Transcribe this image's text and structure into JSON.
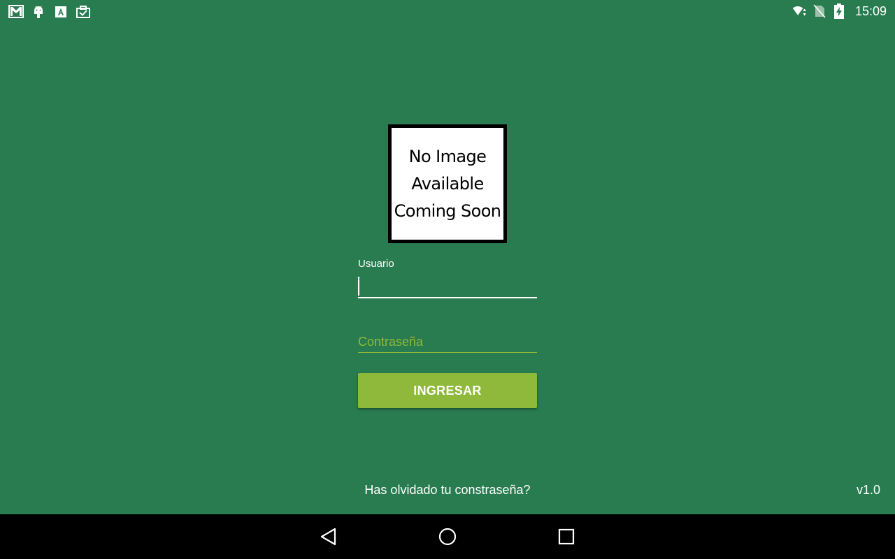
{
  "status_bar": {
    "time": "15:09",
    "left_icons": [
      "gmail-icon",
      "android-icon",
      "keyboard-a-icon",
      "task-icon"
    ],
    "right_icons": [
      "wifi-icon",
      "no-sim-icon",
      "battery-charging-icon"
    ]
  },
  "logo": {
    "lines": [
      "No Image",
      "Available",
      "Coming Soon"
    ]
  },
  "form": {
    "user_label": "Usuario",
    "user_value": "",
    "password_placeholder": "Contraseña",
    "submit_label": "INGRESAR"
  },
  "footer": {
    "forgot_password": "Has olvidado tu constraseña?",
    "version": "v1.0"
  },
  "nav_bar": {
    "buttons": [
      "back-icon",
      "home-icon",
      "recents-icon"
    ]
  },
  "colors": {
    "background": "#297b50",
    "accent": "#8fb93a",
    "nav_bar": "#000000"
  }
}
